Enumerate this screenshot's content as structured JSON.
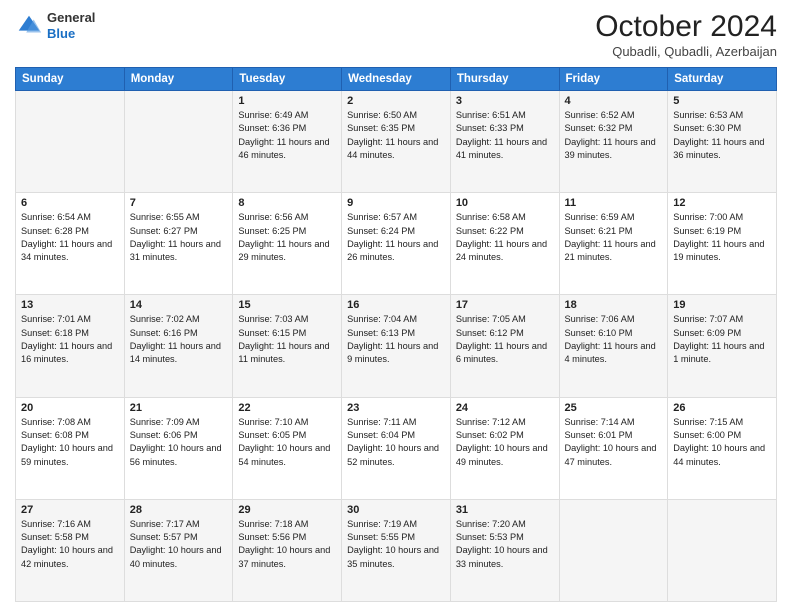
{
  "header": {
    "logo": {
      "general": "General",
      "blue": "Blue"
    },
    "title": "October 2024",
    "location": "Qubadli, Qubadli, Azerbaijan"
  },
  "days_of_week": [
    "Sunday",
    "Monday",
    "Tuesday",
    "Wednesday",
    "Thursday",
    "Friday",
    "Saturday"
  ],
  "weeks": [
    [
      {
        "day": "",
        "sunrise": "",
        "sunset": "",
        "daylight": ""
      },
      {
        "day": "",
        "sunrise": "",
        "sunset": "",
        "daylight": ""
      },
      {
        "day": "1",
        "sunrise": "Sunrise: 6:49 AM",
        "sunset": "Sunset: 6:36 PM",
        "daylight": "Daylight: 11 hours and 46 minutes."
      },
      {
        "day": "2",
        "sunrise": "Sunrise: 6:50 AM",
        "sunset": "Sunset: 6:35 PM",
        "daylight": "Daylight: 11 hours and 44 minutes."
      },
      {
        "day": "3",
        "sunrise": "Sunrise: 6:51 AM",
        "sunset": "Sunset: 6:33 PM",
        "daylight": "Daylight: 11 hours and 41 minutes."
      },
      {
        "day": "4",
        "sunrise": "Sunrise: 6:52 AM",
        "sunset": "Sunset: 6:32 PM",
        "daylight": "Daylight: 11 hours and 39 minutes."
      },
      {
        "day": "5",
        "sunrise": "Sunrise: 6:53 AM",
        "sunset": "Sunset: 6:30 PM",
        "daylight": "Daylight: 11 hours and 36 minutes."
      }
    ],
    [
      {
        "day": "6",
        "sunrise": "Sunrise: 6:54 AM",
        "sunset": "Sunset: 6:28 PM",
        "daylight": "Daylight: 11 hours and 34 minutes."
      },
      {
        "day": "7",
        "sunrise": "Sunrise: 6:55 AM",
        "sunset": "Sunset: 6:27 PM",
        "daylight": "Daylight: 11 hours and 31 minutes."
      },
      {
        "day": "8",
        "sunrise": "Sunrise: 6:56 AM",
        "sunset": "Sunset: 6:25 PM",
        "daylight": "Daylight: 11 hours and 29 minutes."
      },
      {
        "day": "9",
        "sunrise": "Sunrise: 6:57 AM",
        "sunset": "Sunset: 6:24 PM",
        "daylight": "Daylight: 11 hours and 26 minutes."
      },
      {
        "day": "10",
        "sunrise": "Sunrise: 6:58 AM",
        "sunset": "Sunset: 6:22 PM",
        "daylight": "Daylight: 11 hours and 24 minutes."
      },
      {
        "day": "11",
        "sunrise": "Sunrise: 6:59 AM",
        "sunset": "Sunset: 6:21 PM",
        "daylight": "Daylight: 11 hours and 21 minutes."
      },
      {
        "day": "12",
        "sunrise": "Sunrise: 7:00 AM",
        "sunset": "Sunset: 6:19 PM",
        "daylight": "Daylight: 11 hours and 19 minutes."
      }
    ],
    [
      {
        "day": "13",
        "sunrise": "Sunrise: 7:01 AM",
        "sunset": "Sunset: 6:18 PM",
        "daylight": "Daylight: 11 hours and 16 minutes."
      },
      {
        "day": "14",
        "sunrise": "Sunrise: 7:02 AM",
        "sunset": "Sunset: 6:16 PM",
        "daylight": "Daylight: 11 hours and 14 minutes."
      },
      {
        "day": "15",
        "sunrise": "Sunrise: 7:03 AM",
        "sunset": "Sunset: 6:15 PM",
        "daylight": "Daylight: 11 hours and 11 minutes."
      },
      {
        "day": "16",
        "sunrise": "Sunrise: 7:04 AM",
        "sunset": "Sunset: 6:13 PM",
        "daylight": "Daylight: 11 hours and 9 minutes."
      },
      {
        "day": "17",
        "sunrise": "Sunrise: 7:05 AM",
        "sunset": "Sunset: 6:12 PM",
        "daylight": "Daylight: 11 hours and 6 minutes."
      },
      {
        "day": "18",
        "sunrise": "Sunrise: 7:06 AM",
        "sunset": "Sunset: 6:10 PM",
        "daylight": "Daylight: 11 hours and 4 minutes."
      },
      {
        "day": "19",
        "sunrise": "Sunrise: 7:07 AM",
        "sunset": "Sunset: 6:09 PM",
        "daylight": "Daylight: 11 hours and 1 minute."
      }
    ],
    [
      {
        "day": "20",
        "sunrise": "Sunrise: 7:08 AM",
        "sunset": "Sunset: 6:08 PM",
        "daylight": "Daylight: 10 hours and 59 minutes."
      },
      {
        "day": "21",
        "sunrise": "Sunrise: 7:09 AM",
        "sunset": "Sunset: 6:06 PM",
        "daylight": "Daylight: 10 hours and 56 minutes."
      },
      {
        "day": "22",
        "sunrise": "Sunrise: 7:10 AM",
        "sunset": "Sunset: 6:05 PM",
        "daylight": "Daylight: 10 hours and 54 minutes."
      },
      {
        "day": "23",
        "sunrise": "Sunrise: 7:11 AM",
        "sunset": "Sunset: 6:04 PM",
        "daylight": "Daylight: 10 hours and 52 minutes."
      },
      {
        "day": "24",
        "sunrise": "Sunrise: 7:12 AM",
        "sunset": "Sunset: 6:02 PM",
        "daylight": "Daylight: 10 hours and 49 minutes."
      },
      {
        "day": "25",
        "sunrise": "Sunrise: 7:14 AM",
        "sunset": "Sunset: 6:01 PM",
        "daylight": "Daylight: 10 hours and 47 minutes."
      },
      {
        "day": "26",
        "sunrise": "Sunrise: 7:15 AM",
        "sunset": "Sunset: 6:00 PM",
        "daylight": "Daylight: 10 hours and 44 minutes."
      }
    ],
    [
      {
        "day": "27",
        "sunrise": "Sunrise: 7:16 AM",
        "sunset": "Sunset: 5:58 PM",
        "daylight": "Daylight: 10 hours and 42 minutes."
      },
      {
        "day": "28",
        "sunrise": "Sunrise: 7:17 AM",
        "sunset": "Sunset: 5:57 PM",
        "daylight": "Daylight: 10 hours and 40 minutes."
      },
      {
        "day": "29",
        "sunrise": "Sunrise: 7:18 AM",
        "sunset": "Sunset: 5:56 PM",
        "daylight": "Daylight: 10 hours and 37 minutes."
      },
      {
        "day": "30",
        "sunrise": "Sunrise: 7:19 AM",
        "sunset": "Sunset: 5:55 PM",
        "daylight": "Daylight: 10 hours and 35 minutes."
      },
      {
        "day": "31",
        "sunrise": "Sunrise: 7:20 AM",
        "sunset": "Sunset: 5:53 PM",
        "daylight": "Daylight: 10 hours and 33 minutes."
      },
      {
        "day": "",
        "sunrise": "",
        "sunset": "",
        "daylight": ""
      },
      {
        "day": "",
        "sunrise": "",
        "sunset": "",
        "daylight": ""
      }
    ]
  ]
}
